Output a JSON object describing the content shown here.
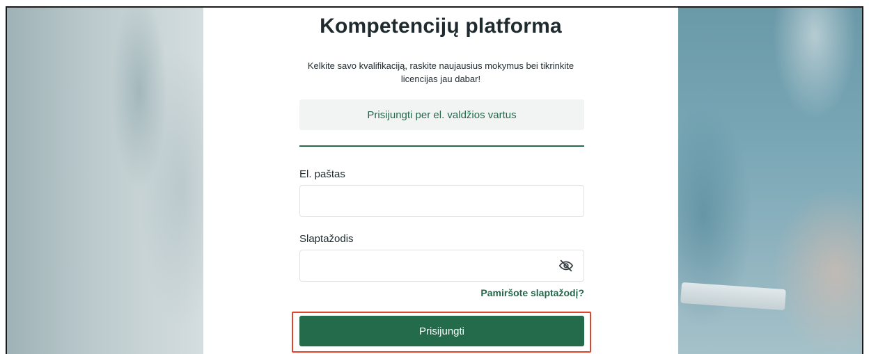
{
  "app": {
    "title": "Kompetencijų platforma",
    "subtitle": "Kelkite savo kvalifikaciją, raskite naujausius mokymus bei tikrinkite licencijas jau dabar!"
  },
  "login": {
    "eid_button_label": "Prisijungti per el. valdžios vartus",
    "email_label": "El. paštas",
    "email_value": "",
    "password_label": "Slaptažodis",
    "password_value": "",
    "password_toggle_icon": "eye-off-icon",
    "forgot_link": "Pamiršote slaptažodį?",
    "submit_label": "Prisijungti"
  },
  "colors": {
    "brand_green": "#236b4b",
    "highlight_red": "#e0442b"
  }
}
